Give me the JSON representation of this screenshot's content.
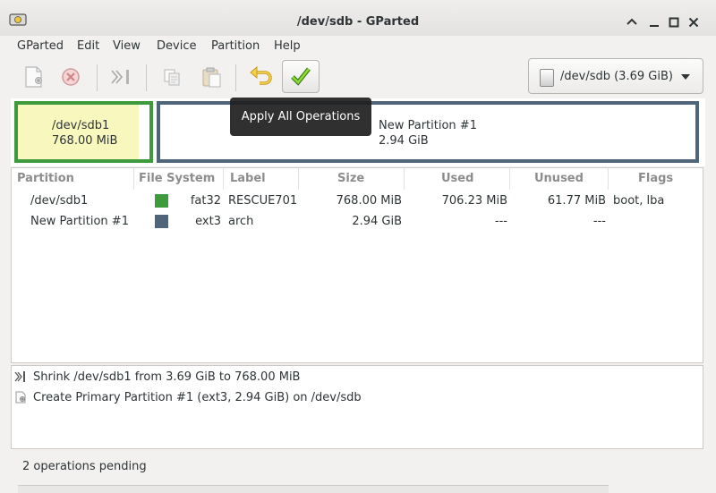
{
  "window": {
    "title": "/dev/sdb - GParted",
    "app_icon": "gparted-disk-icon",
    "controls": [
      "chevron-up-icon",
      "minimize-icon",
      "maximize-icon",
      "close-icon"
    ]
  },
  "menubar": {
    "items": [
      {
        "label": "GParted"
      },
      {
        "label": "Edit"
      },
      {
        "label": "View"
      },
      {
        "label": "Device"
      },
      {
        "label": "Partition"
      },
      {
        "label": "Help"
      }
    ]
  },
  "toolbar": {
    "buttons": [
      {
        "icon": "new-partition-icon",
        "enabled": false
      },
      {
        "icon": "delete-icon",
        "enabled": false
      },
      {
        "icon": "resize-move-icon",
        "enabled": false
      },
      {
        "icon": "copy-icon",
        "enabled": false
      },
      {
        "icon": "paste-icon",
        "enabled": false
      },
      {
        "icon": "undo-icon",
        "enabled": true
      },
      {
        "icon": "apply-icon",
        "enabled": true
      }
    ],
    "tooltip": "Apply All Operations"
  },
  "device_selector": {
    "label": "/dev/sdb (3.69 GiB)",
    "icon": "disk-drive-icon"
  },
  "graphic": {
    "partitions": [
      {
        "name": "/dev/sdb1",
        "size": "768.00 MiB",
        "color": "#3d9b3d",
        "used_fraction": 0.92
      },
      {
        "name": "New Partition #1",
        "size": "2.94 GiB",
        "color": "#4f6579"
      }
    ]
  },
  "table": {
    "headers": [
      "Partition",
      "File System",
      "Label",
      "Size",
      "Used",
      "Unused",
      "Flags"
    ],
    "rows": [
      {
        "partition": "/dev/sdb1",
        "fs_color": "#3d9b3d",
        "file_system": "fat32",
        "label": "RESCUE701",
        "size": "768.00 MiB",
        "used": "706.23 MiB",
        "unused": "61.77 MiB",
        "flags": "boot, lba"
      },
      {
        "partition": "New Partition #1",
        "fs_color": "#4f6579",
        "file_system": "ext3",
        "label": "arch",
        "size": "2.94 GiB",
        "used": "---",
        "unused": "---",
        "flags": ""
      }
    ]
  },
  "operations": [
    {
      "icon": "resize-move-icon",
      "text": "Shrink /dev/sdb1 from 3.69 GiB to 768.00 MiB"
    },
    {
      "icon": "new-partition-icon",
      "text": "Create Primary Partition #1 (ext3, 2.94 GiB) on /dev/sdb"
    }
  ],
  "status": {
    "text": "2 operations pending"
  }
}
